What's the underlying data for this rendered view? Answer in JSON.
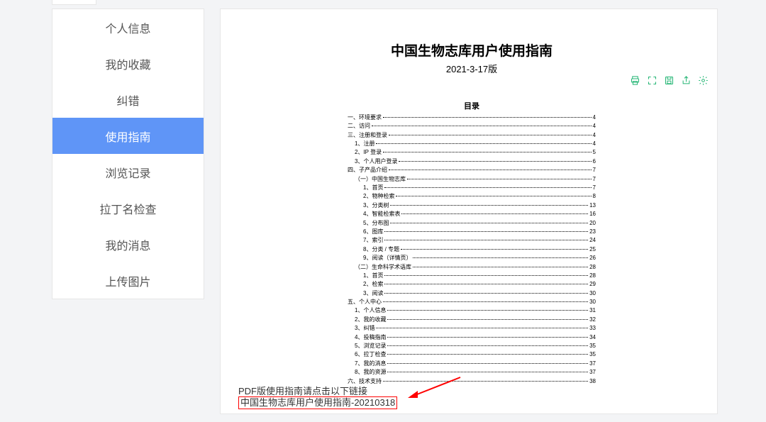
{
  "colors": {
    "accent": "#5f95f7",
    "green": "#22b573",
    "arrow": "#ff0000"
  },
  "sidebar": {
    "items": [
      {
        "label": "个人信息"
      },
      {
        "label": "我的收藏"
      },
      {
        "label": "纠错"
      },
      {
        "label": "使用指南",
        "active": true
      },
      {
        "label": "浏览记录"
      },
      {
        "label": "拉丁名检查"
      },
      {
        "label": "我的消息"
      },
      {
        "label": "上传图片"
      }
    ]
  },
  "doc": {
    "title": "中国生物志库用户使用指南",
    "date": "2021-3-17版",
    "toc_title": "目录",
    "toc": [
      {
        "label": "一、环境要求",
        "page": "4",
        "indent": 0
      },
      {
        "label": "二、访问",
        "page": "4",
        "indent": 0
      },
      {
        "label": "三、注册和登录",
        "page": "4",
        "indent": 0
      },
      {
        "label": "1、注册",
        "page": "4",
        "indent": 1
      },
      {
        "label": "2、IP 登录",
        "page": "5",
        "indent": 1
      },
      {
        "label": "3、个人用户登录",
        "page": "6",
        "indent": 1
      },
      {
        "label": "四、子产品介绍",
        "page": "7",
        "indent": 0
      },
      {
        "label": "（一）中国生物志库",
        "page": "7",
        "indent": 1
      },
      {
        "label": "1、首页",
        "page": "7",
        "indent": 2
      },
      {
        "label": "2、物种检索",
        "page": "8",
        "indent": 2
      },
      {
        "label": "3、分类树",
        "page": "13",
        "indent": 2
      },
      {
        "label": "4、智能检索表",
        "page": "16",
        "indent": 2
      },
      {
        "label": "5、分布图",
        "page": "20",
        "indent": 2
      },
      {
        "label": "6、图库",
        "page": "23",
        "indent": 2
      },
      {
        "label": "7、索引",
        "page": "24",
        "indent": 2
      },
      {
        "label": "8、分类 / 专题",
        "page": "25",
        "indent": 2
      },
      {
        "label": "9、阅读（详情页）",
        "page": "26",
        "indent": 2
      },
      {
        "label": "（二）生命科学术语库",
        "page": "28",
        "indent": 1
      },
      {
        "label": "1、首页",
        "page": "28",
        "indent": 2
      },
      {
        "label": "2、检索",
        "page": "29",
        "indent": 2
      },
      {
        "label": "3、阅读",
        "page": "30",
        "indent": 2
      },
      {
        "label": "五、个人中心",
        "page": "30",
        "indent": 0
      },
      {
        "label": "1、个人信息",
        "page": "31",
        "indent": 1
      },
      {
        "label": "2、我的收藏",
        "page": "32",
        "indent": 1
      },
      {
        "label": "3、纠错",
        "page": "33",
        "indent": 1
      },
      {
        "label": "4、投稿指南",
        "page": "34",
        "indent": 1
      },
      {
        "label": "5、浏览记录",
        "page": "35",
        "indent": 1
      },
      {
        "label": "6、拉丁检查",
        "page": "35",
        "indent": 1
      },
      {
        "label": "7、我的消息",
        "page": "37",
        "indent": 1
      },
      {
        "label": "8、我的资源",
        "page": "37",
        "indent": 1
      },
      {
        "label": "六、技术支持",
        "page": "38",
        "indent": 0
      }
    ],
    "actions": {
      "print": "打印",
      "fullscreen": "全屏",
      "save": "保存",
      "share": "分享",
      "settings": "设置"
    }
  },
  "footer": {
    "note": "PDF版使用指南请点击以下链接",
    "link": "中国生物志库用户使用指南-20210318"
  }
}
